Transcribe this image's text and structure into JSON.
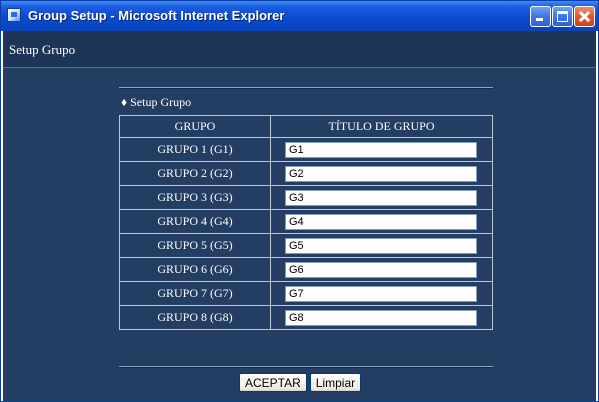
{
  "window": {
    "title": "Group Setup - Microsoft Internet Explorer"
  },
  "page": {
    "header_title": "Setup Grupo",
    "section_label": "♦ Setup Grupo"
  },
  "table": {
    "headers": [
      "GRUPO",
      "TÍTULO DE GRUPO"
    ],
    "rows": [
      {
        "group": "GRUPO 1 (G1)",
        "title": "G1"
      },
      {
        "group": "GRUPO 2 (G2)",
        "title": "G2"
      },
      {
        "group": "GRUPO 3 (G3)",
        "title": "G3"
      },
      {
        "group": "GRUPO 4 (G4)",
        "title": "G4"
      },
      {
        "group": "GRUPO 5 (G5)",
        "title": "G5"
      },
      {
        "group": "GRUPO 6 (G6)",
        "title": "G6"
      },
      {
        "group": "GRUPO 7 (G7)",
        "title": "G7"
      },
      {
        "group": "GRUPO 8 (G8)",
        "title": "G8"
      }
    ]
  },
  "buttons": {
    "accept": "ACEPTAR",
    "clear": "Limpiar"
  },
  "colors": {
    "page_background": "#233d63",
    "header_background": "#1d3557",
    "titlebar": "#0a4ad0",
    "close_button": "#e05a2e"
  },
  "icons": {
    "app": "ie-page-icon",
    "minimize": "minimize-icon",
    "maximize": "maximize-icon",
    "close": "close-icon"
  }
}
